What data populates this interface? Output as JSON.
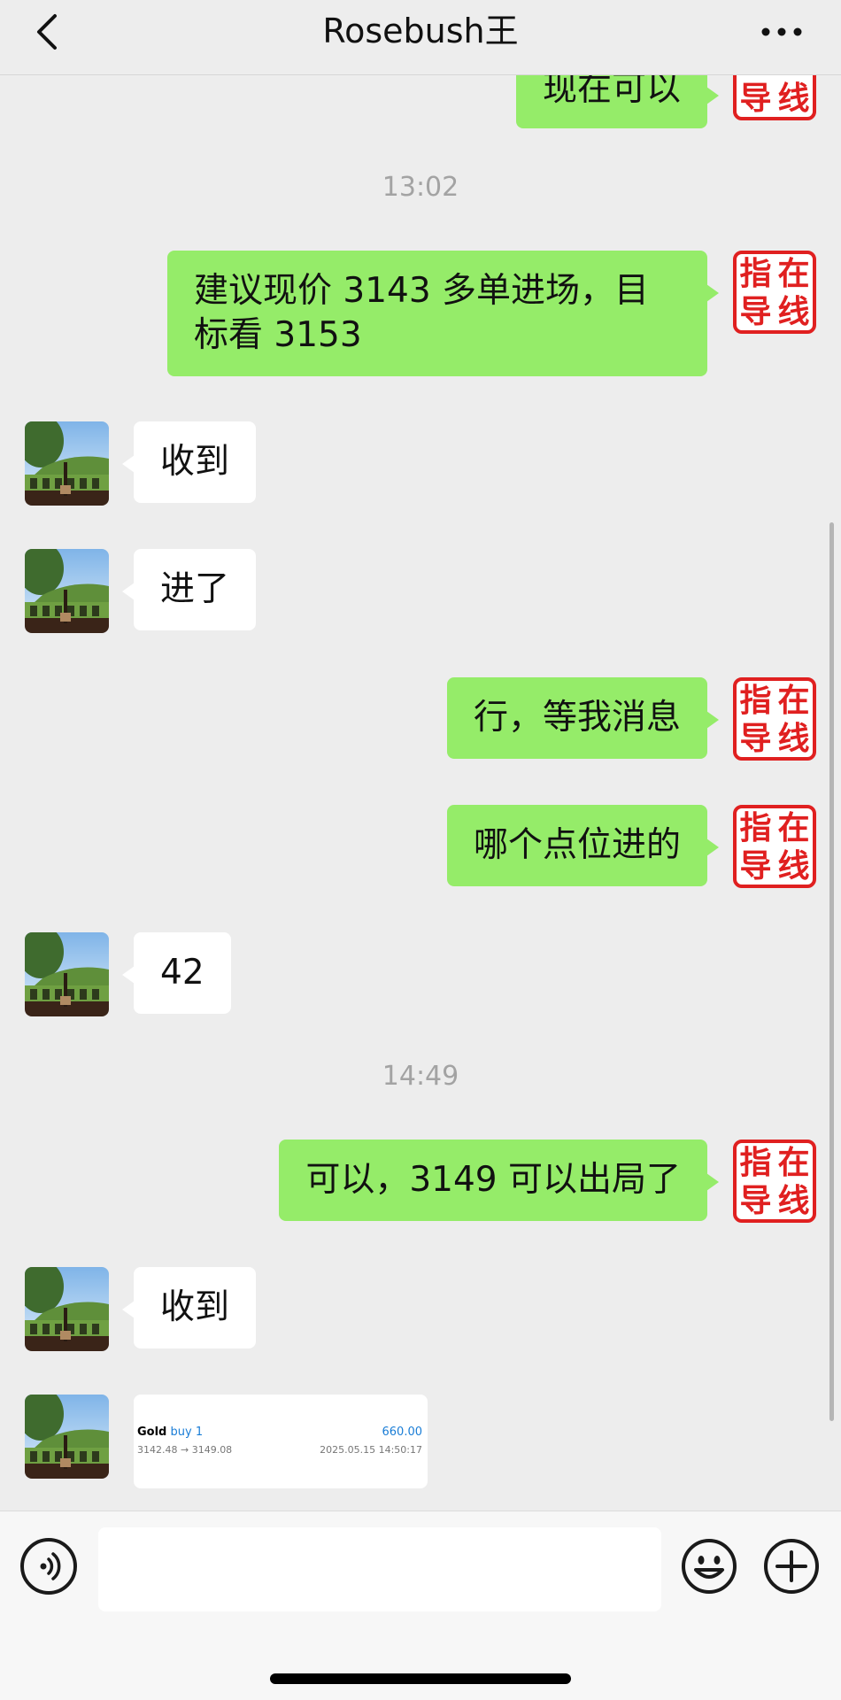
{
  "header": {
    "title": "Rosebush王",
    "back_icon": "chevron-left-icon",
    "more_icon": "ellipsis-icon"
  },
  "self_avatar": {
    "chars": [
      "指",
      "在",
      "导",
      "线"
    ],
    "color": "#e02020"
  },
  "messages": [
    {
      "type": "out",
      "text": "现在可以"
    },
    {
      "type": "time",
      "text": "13:02"
    },
    {
      "type": "out",
      "text": "建议现价 3143 多单进场，目标看 3153"
    },
    {
      "type": "in",
      "text": "收到"
    },
    {
      "type": "in",
      "text": "进了"
    },
    {
      "type": "out",
      "text": "行，等我消息"
    },
    {
      "type": "out",
      "text": "哪个点位进的"
    },
    {
      "type": "in",
      "text": "42"
    },
    {
      "type": "time",
      "text": "14:49"
    },
    {
      "type": "out",
      "text": "可以，3149 可以出局了"
    },
    {
      "type": "in",
      "text": "收到"
    },
    {
      "type": "in_card",
      "card": {
        "symbol": "Gold",
        "side": "buy 1",
        "profit": "660.00",
        "prices": "3142.48 → 3149.08",
        "datetime": "2025.05.15 14:50:17"
      }
    }
  ],
  "input": {
    "value": "",
    "placeholder": ""
  },
  "colors": {
    "outgoing_bubble": "#95ec69",
    "incoming_bubble": "#ffffff",
    "background": "#ededed",
    "accent_blue": "#1a7dd6"
  }
}
